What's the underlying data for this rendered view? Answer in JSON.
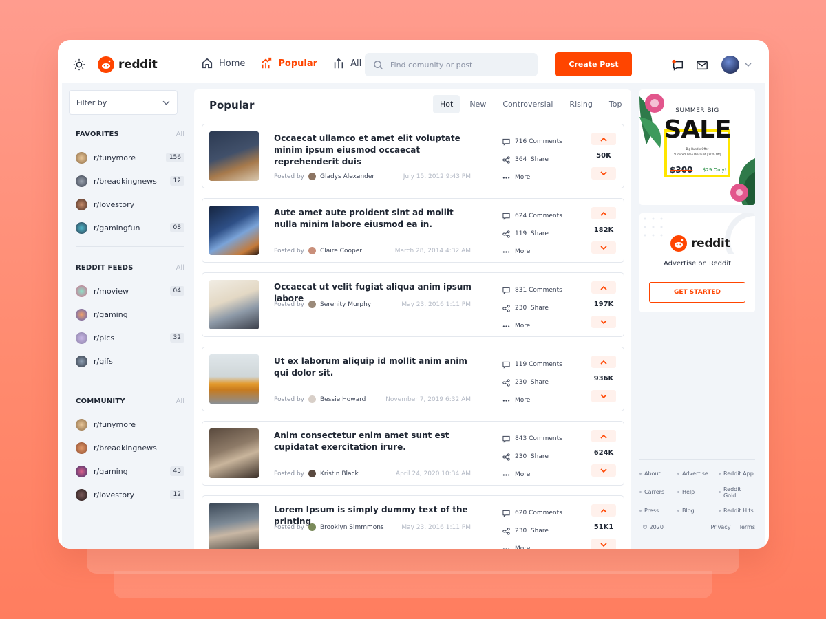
{
  "header": {
    "logo_text": "reddit",
    "nav": [
      {
        "label": "Home",
        "icon": "home-icon"
      },
      {
        "label": "Popular",
        "icon": "trending-icon"
      },
      {
        "label": "All",
        "icon": "all-icon"
      }
    ],
    "search_placeholder": "Find comunity or post",
    "create_post_label": "Create Post",
    "accent_color": "#ff4500"
  },
  "sidebar": {
    "filter_label": "Filter by",
    "favorites": {
      "title": "FAVORITES",
      "all_label": "All",
      "items": [
        {
          "name": "r/funymore",
          "badge": "156"
        },
        {
          "name": "r/breadkingnews",
          "badge": "12"
        },
        {
          "name": "r/lovestory",
          "badge": ""
        },
        {
          "name": "r/gamingfun",
          "badge": "08"
        }
      ]
    },
    "feeds": {
      "title": "REDDIT FEEDS",
      "all_label": "All",
      "items": [
        {
          "name": "r/moview",
          "badge": "04"
        },
        {
          "name": "r/gaming",
          "badge": ""
        },
        {
          "name": "r/pics",
          "badge": "32"
        },
        {
          "name": "r/gifs",
          "badge": ""
        }
      ]
    },
    "community": {
      "title": "COMMUNITY",
      "all_label": "All",
      "items": [
        {
          "name": "r/funymore",
          "badge": ""
        },
        {
          "name": "r/breadkingnews",
          "badge": ""
        },
        {
          "name": "r/gaming",
          "badge": "43"
        },
        {
          "name": "r/lovestory",
          "badge": "12"
        }
      ]
    }
  },
  "feed": {
    "title": "Popular",
    "tabs": [
      "Hot",
      "New",
      "Controversial",
      "Rising",
      "Top"
    ],
    "active_tab": "Hot",
    "posted_by_label": "Posted by",
    "comments_suffix": "Comments",
    "share_label": "Share",
    "more_label": "More",
    "posts": [
      {
        "title": "Occaecat ullamco et amet elit voluptate minim ipsum eiusmod occaecat reprehenderit duis",
        "author": "Gladys Alexander",
        "date": "July 15, 2012 9:43 PM",
        "comments": "716",
        "shares": "364",
        "votes": "50K"
      },
      {
        "title": "Aute amet aute proident sint ad mollit nulla minim labore eiusmod ea in.",
        "author": "Claire Cooper",
        "date": "March 28, 2014 4:32 AM",
        "comments": "624",
        "shares": "119",
        "votes": "182K"
      },
      {
        "title": "Occaecat ut velit fugiat aliqua anim ipsum labore",
        "author": "Serenity Murphy",
        "date": "May 23, 2016 1:11 PM",
        "comments": "831",
        "shares": "230",
        "votes": "197K"
      },
      {
        "title": "Ut ex laborum aliquip id mollit anim anim qui dolor sit.",
        "author": "Bessie Howard",
        "date": "November 7, 2019 6:32 AM",
        "comments": "119",
        "shares": "230",
        "votes": "936K"
      },
      {
        "title": "Anim consectetur enim amet sunt est cupidatat exercitation irure.",
        "author": "Kristin Black",
        "date": "April 24, 2020 10:34 AM",
        "comments": "843",
        "shares": "230",
        "votes": "624K"
      },
      {
        "title": "Lorem Ipsum is simply dummy text of the printing",
        "author": "Brooklyn Simmmons",
        "date": "May 23, 2016 1:11 PM",
        "comments": "620",
        "shares": "230",
        "votes": "51K1"
      }
    ]
  },
  "ad": {
    "line1": "SUMMER BIG",
    "headline": "SALE",
    "sub1": "Big Bundle Offer",
    "sub2": "*Limited Time Discount | 90% Off|",
    "old_price": "$300",
    "new_price": "$29 Only!"
  },
  "promo": {
    "logo_text": "reddit",
    "text": "Advertise on Reddit",
    "button_label": "GET STARTED"
  },
  "footer": {
    "links": [
      "About",
      "Advertise",
      "Reddit App",
      "Carrers",
      "Help",
      "Reddit Gold",
      "Press",
      "Blog",
      "Reddit Hits"
    ],
    "copyright": "© 2020",
    "privacy": "Privacy",
    "terms": "Terms"
  }
}
